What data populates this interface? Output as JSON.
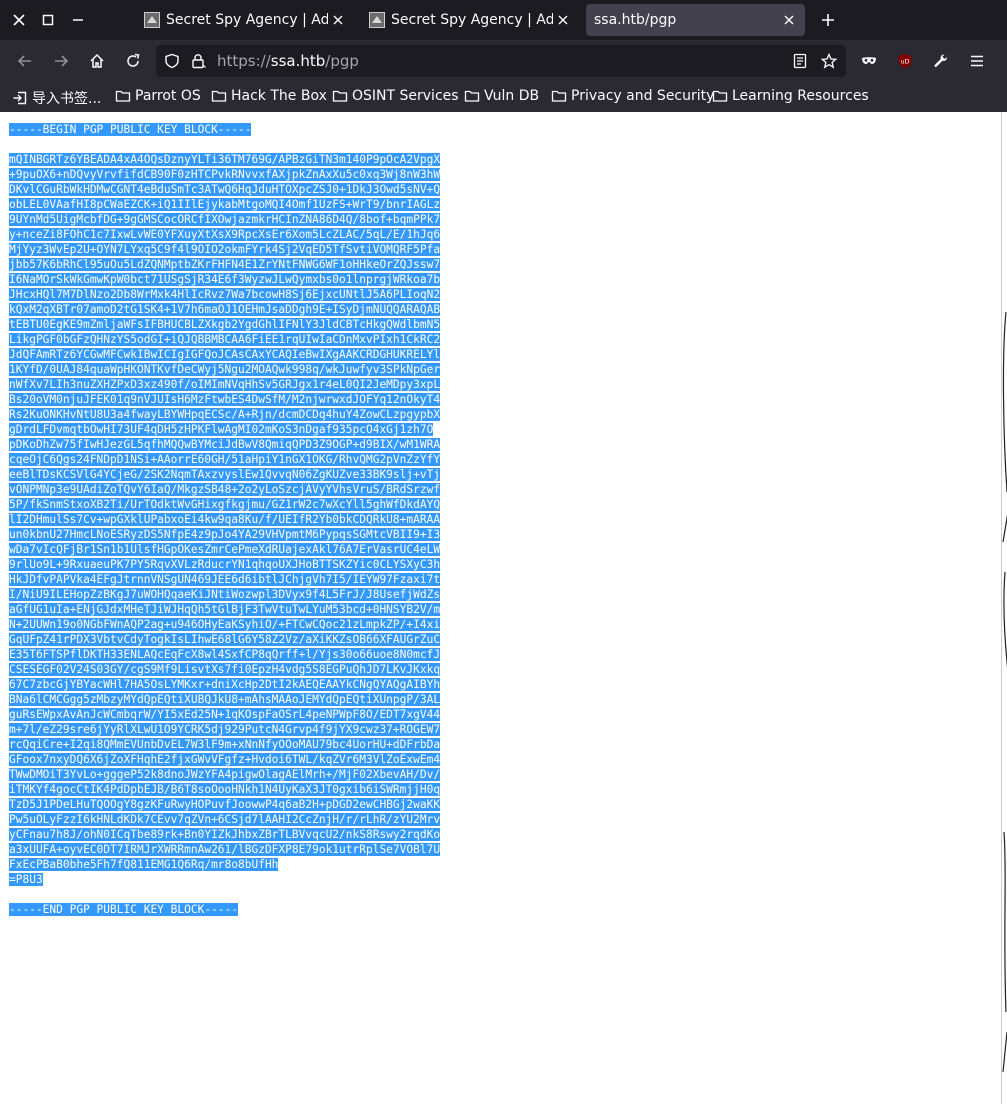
{
  "tabs": [
    {
      "title": "Secret Spy Agency | Admi",
      "active": false
    },
    {
      "title": "Secret Spy Agency | Admi",
      "active": false
    },
    {
      "title": "ssa.htb/pgp",
      "active": true
    }
  ],
  "url": {
    "prefix": "https://",
    "host": "ssa.htb",
    "path": "/pgp"
  },
  "bookmarks": [
    {
      "label": "导入书签...",
      "icon": "import-icon"
    },
    {
      "label": "Parrot OS",
      "icon": "folder-icon"
    },
    {
      "label": "Hack The Box",
      "icon": "folder-icon"
    },
    {
      "label": "OSINT Services",
      "icon": "folder-icon"
    },
    {
      "label": "Vuln DB",
      "icon": "folder-icon"
    },
    {
      "label": "Privacy and Security",
      "icon": "folder-icon"
    },
    {
      "label": "Learning Resources",
      "icon": "folder-icon"
    }
  ],
  "pgp": {
    "begin": "-----BEGIN PGP PUBLIC KEY BLOCK-----",
    "lines": [
      "mQINBGRTz6YBEADA4xA4OQsDznyYLTi36TM769G/APBzGiTN3m140P9pOcA2VpgX",
      "+9puOX6+nDQvyVrvfifdCB90F0zHTCPvkRNvvxfAXjpkZnAxXu5c0xq3Wj8nW3hW",
      "DKvlCGuRbWkHDMwCGNT4eBduSmTc3ATwQ6HqJduHTOXpcZSJ0+1DkJ3Owd5sNV+Q",
      "obLEL0VAafHI8pCWaEZCK+iQ1IIlEjykabMtgoMQI4Omf1UzFS+WrT9/bnrIAGLz",
      "9UYnMd5UigMcbfDG+9gGMSCocORCfIXOwjazmkrHCInZNA86D4Q/8bof+bqmPPk7",
      "y+nceZi8FOhC1c7IxwLvWE0YFXuyXtXsX9RpcXsEr6Xom5LcZLAC/5qL/E/1hJq6",
      "MjYyz3WvEp2U+OYN7LYxq5C9f4l9OIO2okmFYrk4Sj2VqED5TfSvtiVOMQRF5Pfa",
      "jbb57K6bRhCl95uOu5LdZQNMptbZKrFHFN4E1ZrYNtFNWG6WF1oHHkeOrZQJssw7",
      "I6NaMOrSkWkGmwKpW0bct71USgSjR34E6f3WyzwJLwQymxbs0o1lnprgjWRkoa7b",
      "JHcxHQl7M7DlNzo2Db8WrMxk4HlIcRvz7Wa7bcowH8Sj6EjxcUNtlJ5A6PLIoqN2",
      "kQxM2qXBTr07amoD2tG1SK4+1V7h6maOJ1OEHmJsaDDgh9E+ISyDjmNUQQARAQAB",
      "tEBTU0EgKE9mZmljaWFsIFBHUCBLZXkgb2YgdGhlIFNlY3JldCBTcHkgQWdlbmN5",
      "LikgPGF0bGFzQHNzYS5odGI+iQJQBBMBCAA6FiEE1rqUIwIaCDnMxvPIxh1CkRC2",
      "JdQFAmRTz6YCGwMFCwkIBwICIgIGFQoJCAsCAxYCAQIeBwIXgAAKCRDGHUKRELYl",
      "1KYfD/0UAJ84quaWpHKONTKvfDeCWyj5Ngu2MOAQwk998q/wkJuwfyv3SPkNpGer",
      "nWfXv7LIh3nuZXHZPxD3xz490f/oIMImNVqHhSv5GRJgx1r4eL0QI2JeMDpy3xpL",
      "Bs20oVM0njuJFEK01q9nVJUIsH6MzFtwbES4DwSfM/M2njwrwxdJOFYq12nOkyT4",
      "Rs2KuONKHvNtU8U3a4fwayLBYWHpqECSc/A+Rjn/dcmDCDq4huY4ZowCLzpgypbX",
      "gDrdLFDvmqtbOwHI73UF4qDH5zHPKFlwAgMI02mKoS3nDgaf935pcO4xGj1zh7O",
      "pDKoDhZw75fIwHJezGL5qfhMQQwBYMciJdBwV8QmiqQPD3Z9OGP+d9BIX/wM1WRA",
      "cqeOjC6Qgs24FNDpD1NSi+AAorrE60GH/51aHpiY1nGX1OKG/RhvQMG2pVnZzYfY",
      "eeBlTDsKCSVlG4YCjeG/2SK2NqmTAxzvyslEw1QvvqN06ZgKUZve33BK9slj+vTj",
      "vONPMNp3e9UAdiZoTQvY6IaQ/MkgzSB48+2o2yLoSzcjAVyYVhsVruS/BRdSrzwf",
      "5P/fkSnmStxoXB2Ti/UrTOdktWvGHixgfkgjmu/GZ1rW2c7wXcYll5ghWfDkdAYQ",
      "lI2DHmulSs7Cv+wpGXklUPabxoEi4kw9qa8Ku/f/UEIfR2Yb0bkCDQRkU8+mARAA",
      "un0kbnU27HmcLNoESRyzDS5NfpE4z9pJo4YA29VHVpmtM6PypqsSGMtcVBII9+I3",
      "wDa7vIcQFjBr1Sn1b1UlsfHGpOKesZmrCePmeXdRUajexAkl76A7ErVasrUC4eLW",
      "9rlUo9L+9RxuaeuPK7PY5RqvXVLzRducrYN1qhqoUXJHoBTTSKZYic0CLYSXyC3h",
      "HkJDfvPAPVka4EFgJtrnnVNSgUN469JEE6d6ibtlJChjgVh7I5/IEYW97Fzaxi7t",
      "I/NiU9ILEHopZzBKgJ7uWOHQqaeKiJNtiWozwpl3DVyx9f4L5FrJ/J8UsefjWdZs",
      "aGfUG1uIa+ENjGJdxMHeTJiWJHqQh5tGlBjF3TwVtuTwLYuM53bcd+0HNSYB2V/m",
      "N+2UUWn19o0NGbFWnAQP2ag+u946OHyEaKSyhiO/+FTCwCQoc21zLmpkZP/+I4xi",
      "GqUFpZ41rPDX3VbtvCdyTogkIsLIhwE68lG6Y58Z2Vz/aXiKKZsOB66XFAUGrZuC",
      "E35T6FTSPflDKTH33ENLAQcEqFcX8wl4SxfCP8qQrff+l/Yjs30o66uoe8N0mcfJ",
      "CSESEGF02V24S03GY/cgS9Mf9LisvtXs7fi0EpzH4vdg5S8EGPuQhJD7LKvJKxkq",
      "67C7zbcGjYBYacWHl7HA5OsLYMKxr+dniXcHp2DtI2kAEQEAAYkCNgQYAQgAIBYh",
      "BNa6lCMCGgg5zMbzyMYdQpEQtiXUBQJkU8+mAhsMAAoJEMYdQpEQtiXUnpgP/3AL",
      "guRsEWpxAvAnJcWCmbqrW/YI5xEd25N+1qKOspFaOSrL4peNPWpF8O/EDT7xgV44",
      "m+7l/eZ29sre6jYyRlXLwU1O9YCRK5dj929PutcN4Grvp4f9jYX9cwz37+ROGEW7",
      "rcQqiCre+I2qi8QMmEVUnbDvEL7W3lF9m+xNnNfyOOoMAU79bc4UorHU+dDFrbDa",
      "GFoox7nxyDQ6X6jZoXFHqhE2fjxGWvVFgfz+Hvdoi6TWL/kqZVr6M3VlZoExwEm4",
      "TWwDMOiT3YvLo+gggeP52k8dnoJWzYFA4pigwOlagAElMrh+/MjF02XbevAH/Dv/",
      "iTMKYf4gocCtIK4PdDpbEJB/B6T8soOooHNkh1N4UyKaX3JT0gxib6iSWRmjjH0q",
      "TzD5J1PDeLHuTQOOgY8gzKFuRwyHOPuvfJoowwP4q6aB2H+pDGD2ewCHBGj2waKK",
      "Pw5uOLyFzzI6kHNLdKDk7CEvv7qZVn+6CSjd7lAAHI2CcZnjH/r/rLhR/zYU2Mrv",
      "yCFnau7h8J/ohN0ICqTbe89rk+Bn0YIZkJhbxZBrTLBVvqcU2/nkS8Rswy2rqdKo",
      "a3xUUFA+oyvEC0DT7IRMJrXWRRmnAw261/lBGzDFXP8E79ok1utrRplSe7VOBl7U",
      "FxEcPBaB0bhe5Fh7fQ811EMG1Q6Rq/mr8o8bUfHh",
      "=P8U3"
    ],
    "end": "-----END PGP PUBLIC KEY BLOCK-----"
  }
}
